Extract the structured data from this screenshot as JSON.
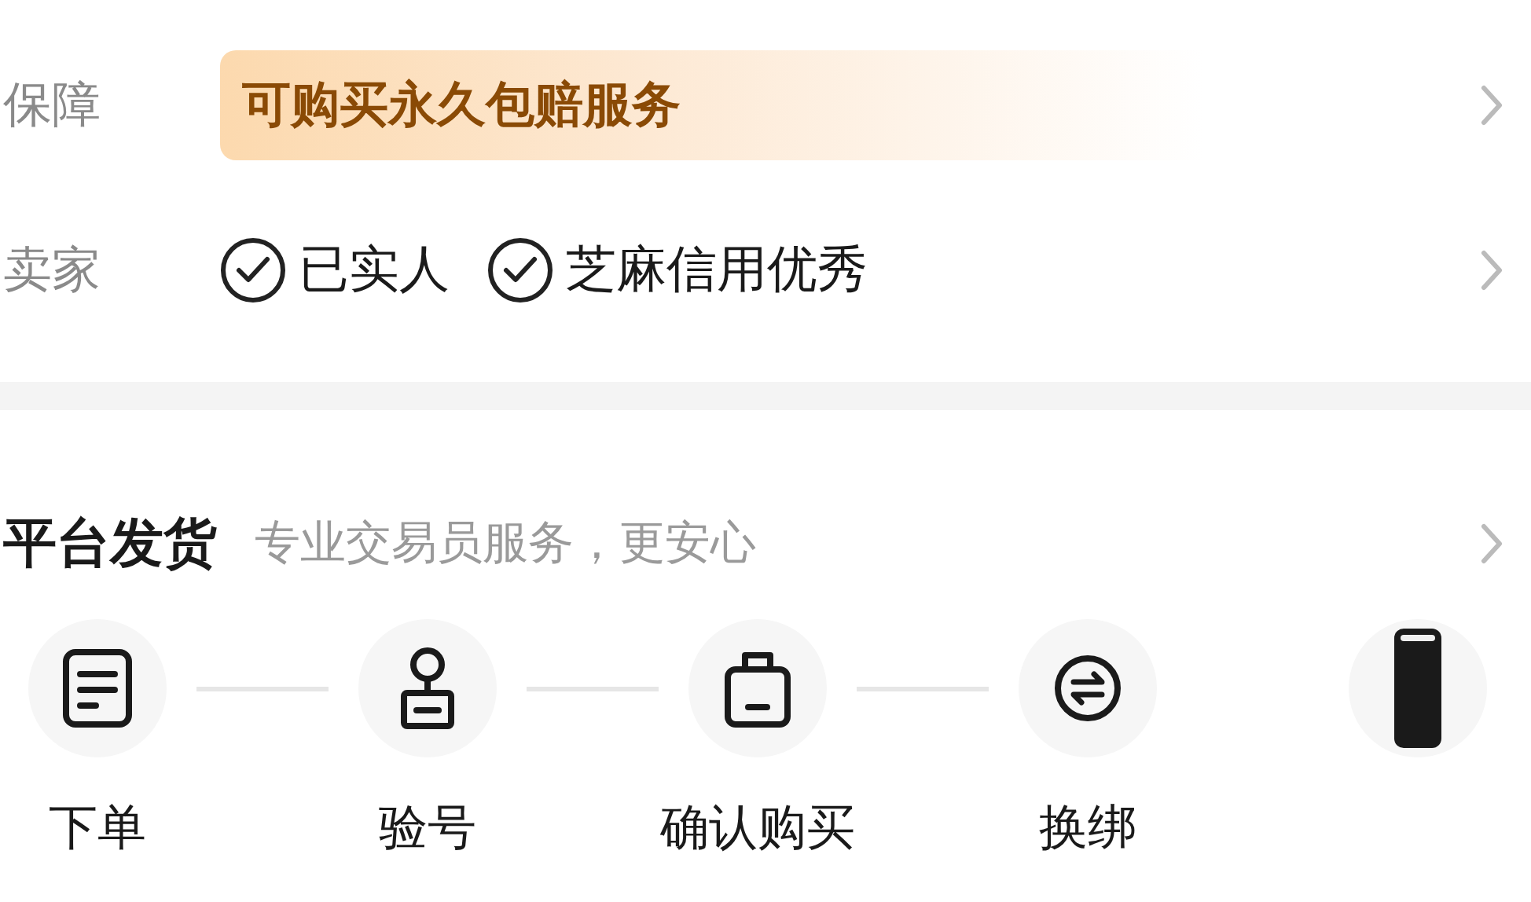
{
  "guarantee": {
    "label": "保障",
    "banner": "可购买永久包赔服务"
  },
  "seller": {
    "label": "卖家",
    "badges": [
      "已实人",
      "芝麻信用优秀"
    ]
  },
  "delivery": {
    "title": "平台发货",
    "subtitle": "专业交易员服务，更安心",
    "steps": [
      {
        "kind": "order",
        "label": "下单"
      },
      {
        "kind": "verify",
        "label": "验号"
      },
      {
        "kind": "bag",
        "label": "确认购买"
      },
      {
        "kind": "swap",
        "label": "换绑"
      },
      {
        "kind": "phone"
      }
    ]
  }
}
